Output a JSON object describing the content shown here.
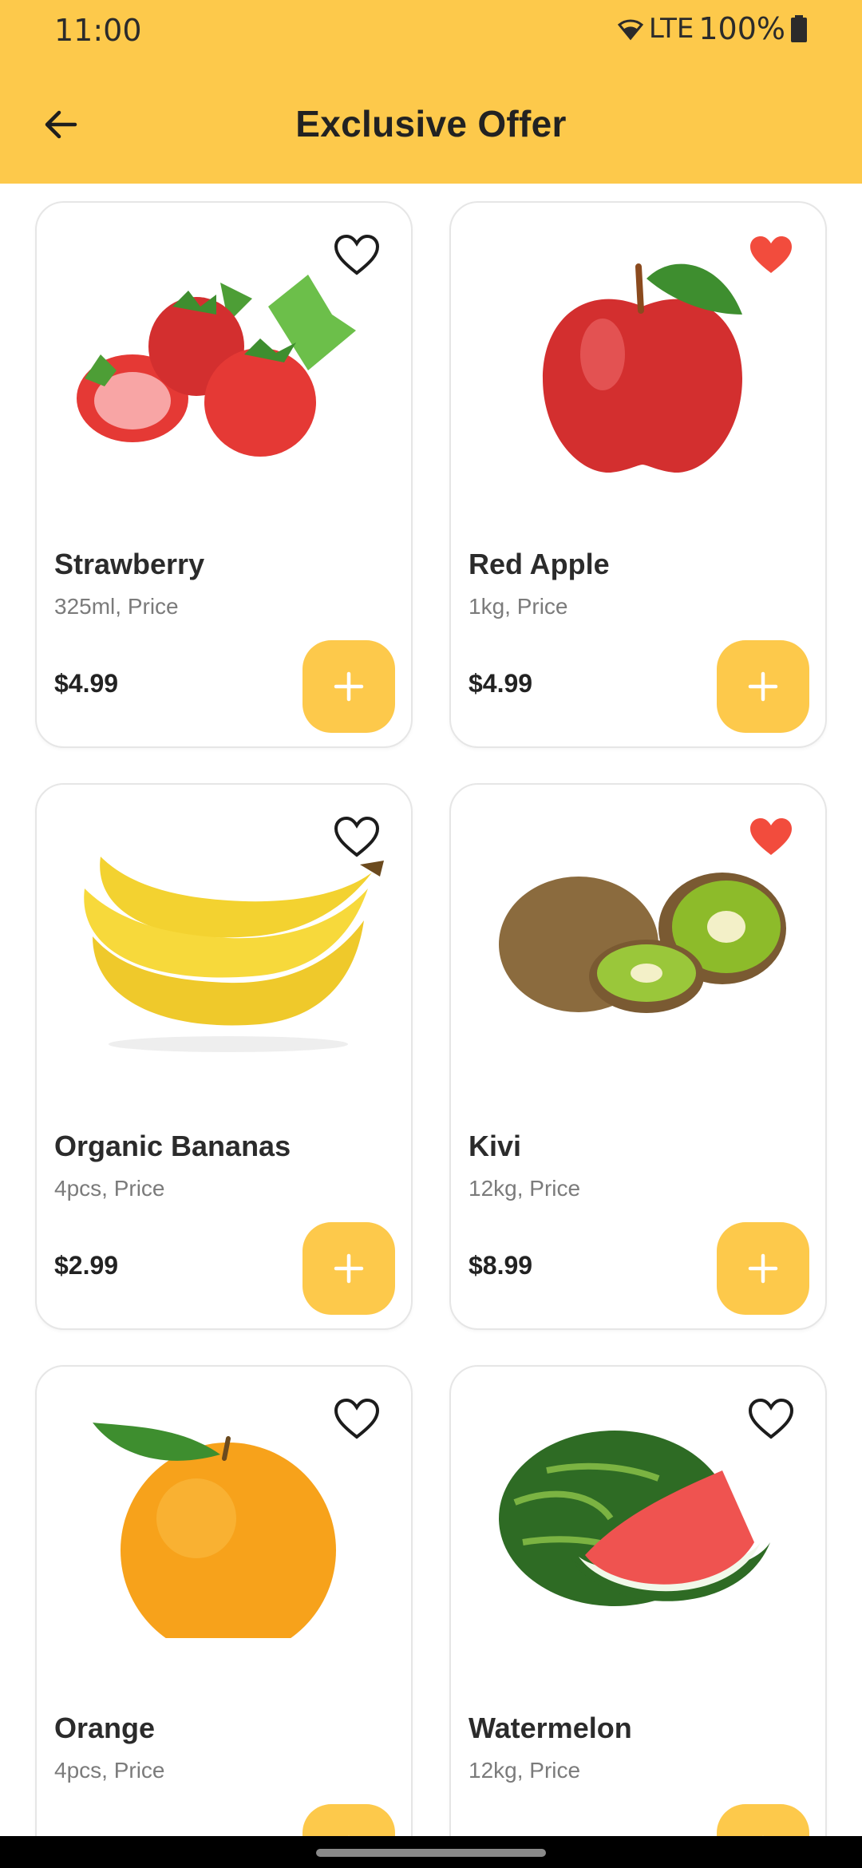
{
  "status": {
    "time": "11:00",
    "network": "LTE",
    "battery": "100%"
  },
  "header": {
    "title": "Exclusive Offer"
  },
  "colors": {
    "accent": "#FDC94B",
    "favorite_active": "#F24C3D"
  },
  "products": [
    {
      "name": "Strawberry",
      "detail": "325ml, Price",
      "price": "$4.99",
      "favorite": false,
      "image": "strawberry"
    },
    {
      "name": "Red Apple",
      "detail": "1kg, Price",
      "price": "$4.99",
      "favorite": true,
      "image": "apple"
    },
    {
      "name": "Organic Bananas",
      "detail": "4pcs, Price",
      "price": "$2.99",
      "favorite": false,
      "image": "banana"
    },
    {
      "name": "Kivi",
      "detail": "12kg, Price",
      "price": "$8.99",
      "favorite": true,
      "image": "kiwi"
    },
    {
      "name": "Orange",
      "detail": "4pcs, Price",
      "price": "",
      "favorite": false,
      "image": "orange"
    },
    {
      "name": "Watermelon",
      "detail": "12kg, Price",
      "price": "",
      "favorite": false,
      "image": "watermelon"
    }
  ]
}
